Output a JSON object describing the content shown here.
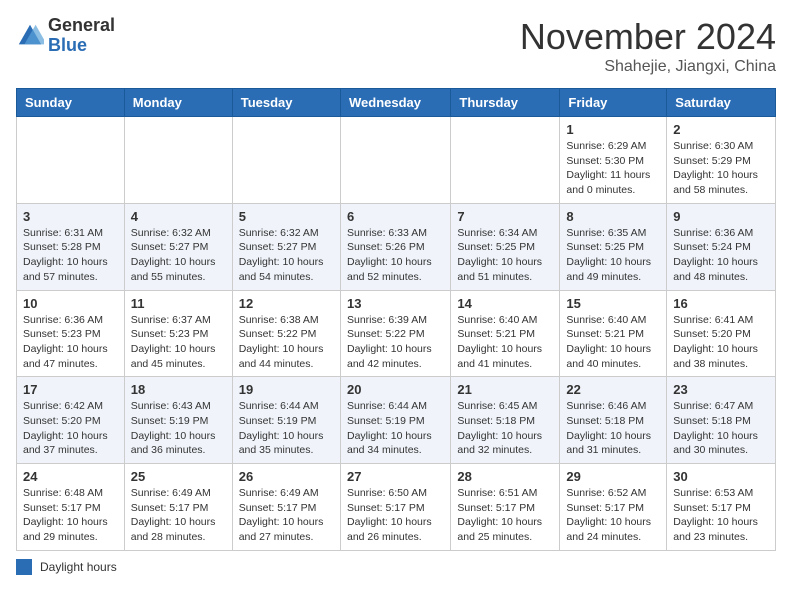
{
  "header": {
    "logo_general": "General",
    "logo_blue": "Blue",
    "month_title": "November 2024",
    "location": "Shahejie, Jiangxi, China"
  },
  "legend": {
    "text": "Daylight hours"
  },
  "days_of_week": [
    "Sunday",
    "Monday",
    "Tuesday",
    "Wednesday",
    "Thursday",
    "Friday",
    "Saturday"
  ],
  "weeks": [
    [
      {
        "day": "",
        "info": ""
      },
      {
        "day": "",
        "info": ""
      },
      {
        "day": "",
        "info": ""
      },
      {
        "day": "",
        "info": ""
      },
      {
        "day": "",
        "info": ""
      },
      {
        "day": "1",
        "info": "Sunrise: 6:29 AM\nSunset: 5:30 PM\nDaylight: 11 hours and 0 minutes."
      },
      {
        "day": "2",
        "info": "Sunrise: 6:30 AM\nSunset: 5:29 PM\nDaylight: 10 hours and 58 minutes."
      }
    ],
    [
      {
        "day": "3",
        "info": "Sunrise: 6:31 AM\nSunset: 5:28 PM\nDaylight: 10 hours and 57 minutes."
      },
      {
        "day": "4",
        "info": "Sunrise: 6:32 AM\nSunset: 5:27 PM\nDaylight: 10 hours and 55 minutes."
      },
      {
        "day": "5",
        "info": "Sunrise: 6:32 AM\nSunset: 5:27 PM\nDaylight: 10 hours and 54 minutes."
      },
      {
        "day": "6",
        "info": "Sunrise: 6:33 AM\nSunset: 5:26 PM\nDaylight: 10 hours and 52 minutes."
      },
      {
        "day": "7",
        "info": "Sunrise: 6:34 AM\nSunset: 5:25 PM\nDaylight: 10 hours and 51 minutes."
      },
      {
        "day": "8",
        "info": "Sunrise: 6:35 AM\nSunset: 5:25 PM\nDaylight: 10 hours and 49 minutes."
      },
      {
        "day": "9",
        "info": "Sunrise: 6:36 AM\nSunset: 5:24 PM\nDaylight: 10 hours and 48 minutes."
      }
    ],
    [
      {
        "day": "10",
        "info": "Sunrise: 6:36 AM\nSunset: 5:23 PM\nDaylight: 10 hours and 47 minutes."
      },
      {
        "day": "11",
        "info": "Sunrise: 6:37 AM\nSunset: 5:23 PM\nDaylight: 10 hours and 45 minutes."
      },
      {
        "day": "12",
        "info": "Sunrise: 6:38 AM\nSunset: 5:22 PM\nDaylight: 10 hours and 44 minutes."
      },
      {
        "day": "13",
        "info": "Sunrise: 6:39 AM\nSunset: 5:22 PM\nDaylight: 10 hours and 42 minutes."
      },
      {
        "day": "14",
        "info": "Sunrise: 6:40 AM\nSunset: 5:21 PM\nDaylight: 10 hours and 41 minutes."
      },
      {
        "day": "15",
        "info": "Sunrise: 6:40 AM\nSunset: 5:21 PM\nDaylight: 10 hours and 40 minutes."
      },
      {
        "day": "16",
        "info": "Sunrise: 6:41 AM\nSunset: 5:20 PM\nDaylight: 10 hours and 38 minutes."
      }
    ],
    [
      {
        "day": "17",
        "info": "Sunrise: 6:42 AM\nSunset: 5:20 PM\nDaylight: 10 hours and 37 minutes."
      },
      {
        "day": "18",
        "info": "Sunrise: 6:43 AM\nSunset: 5:19 PM\nDaylight: 10 hours and 36 minutes."
      },
      {
        "day": "19",
        "info": "Sunrise: 6:44 AM\nSunset: 5:19 PM\nDaylight: 10 hours and 35 minutes."
      },
      {
        "day": "20",
        "info": "Sunrise: 6:44 AM\nSunset: 5:19 PM\nDaylight: 10 hours and 34 minutes."
      },
      {
        "day": "21",
        "info": "Sunrise: 6:45 AM\nSunset: 5:18 PM\nDaylight: 10 hours and 32 minutes."
      },
      {
        "day": "22",
        "info": "Sunrise: 6:46 AM\nSunset: 5:18 PM\nDaylight: 10 hours and 31 minutes."
      },
      {
        "day": "23",
        "info": "Sunrise: 6:47 AM\nSunset: 5:18 PM\nDaylight: 10 hours and 30 minutes."
      }
    ],
    [
      {
        "day": "24",
        "info": "Sunrise: 6:48 AM\nSunset: 5:17 PM\nDaylight: 10 hours and 29 minutes."
      },
      {
        "day": "25",
        "info": "Sunrise: 6:49 AM\nSunset: 5:17 PM\nDaylight: 10 hours and 28 minutes."
      },
      {
        "day": "26",
        "info": "Sunrise: 6:49 AM\nSunset: 5:17 PM\nDaylight: 10 hours and 27 minutes."
      },
      {
        "day": "27",
        "info": "Sunrise: 6:50 AM\nSunset: 5:17 PM\nDaylight: 10 hours and 26 minutes."
      },
      {
        "day": "28",
        "info": "Sunrise: 6:51 AM\nSunset: 5:17 PM\nDaylight: 10 hours and 25 minutes."
      },
      {
        "day": "29",
        "info": "Sunrise: 6:52 AM\nSunset: 5:17 PM\nDaylight: 10 hours and 24 minutes."
      },
      {
        "day": "30",
        "info": "Sunrise: 6:53 AM\nSunset: 5:17 PM\nDaylight: 10 hours and 23 minutes."
      }
    ]
  ]
}
